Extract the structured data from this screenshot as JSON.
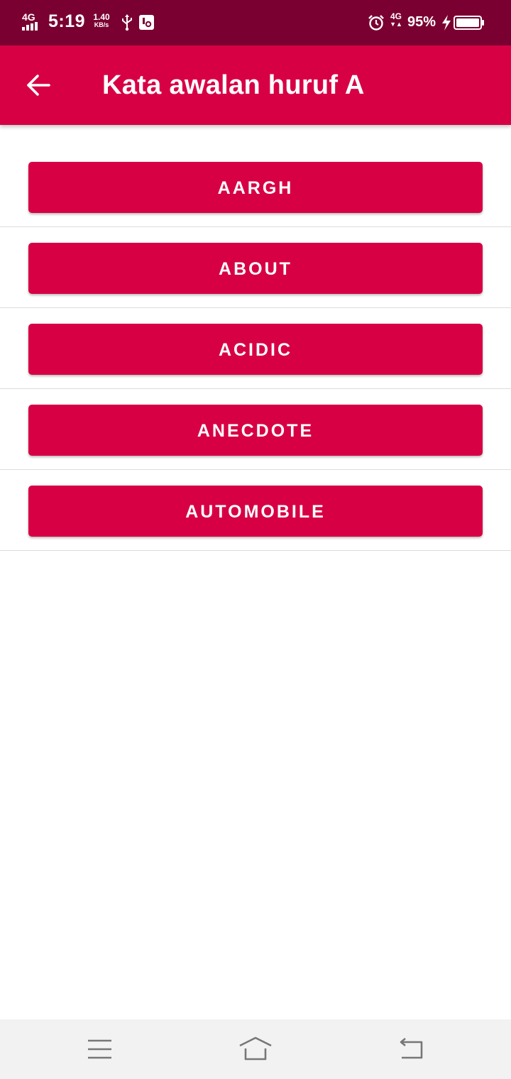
{
  "status_bar": {
    "network_type": "4G",
    "time": "5:19",
    "speed_value": "1.40",
    "speed_unit": "KB/s",
    "secondary_network": "4G",
    "battery_percent": "95%",
    "icons": [
      "signal-icon",
      "usb-icon",
      "device-icon",
      "alarm-icon",
      "data-arrows-icon",
      "charging-bolt-icon",
      "battery-icon"
    ]
  },
  "app_bar": {
    "title": "Kata awalan huruf A",
    "back_icon": "arrow-left-icon",
    "background_color": "#d70045"
  },
  "words": [
    {
      "label": "AARGH"
    },
    {
      "label": "ABOUT"
    },
    {
      "label": "ACIDIC"
    },
    {
      "label": "ANECDOTE"
    },
    {
      "label": "AUTOMOBILE"
    }
  ],
  "colors": {
    "status_bar": "#7a0031",
    "accent": "#d70045",
    "button_text": "#ffffff",
    "divider": "#dcdcdc",
    "nav_bar": "#f2f2f2"
  },
  "nav_bar": {
    "icons": [
      "menu-icon",
      "home-icon",
      "back-icon"
    ]
  }
}
